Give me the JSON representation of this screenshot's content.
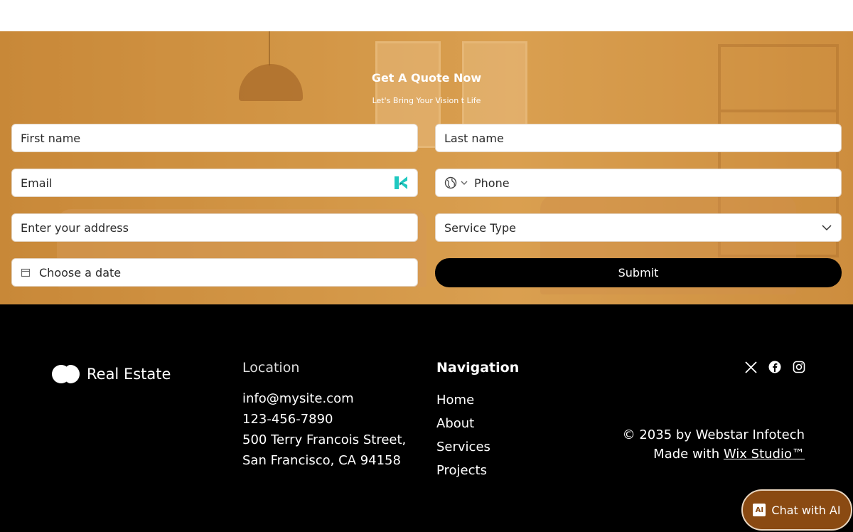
{
  "form": {
    "title": "Get A Quote Now",
    "subtitle": "Let's Bring Your Vision t Life",
    "first_name_placeholder": "First name",
    "last_name_placeholder": "Last name",
    "email_placeholder": "Email",
    "phone_placeholder": "Phone",
    "address_placeholder": "Enter your address",
    "service_placeholder": "Service Type",
    "date_placeholder": "Choose a date",
    "submit_label": "Submit"
  },
  "footer": {
    "brand": "Real Estate",
    "location": {
      "heading": "Location",
      "email": "info@mysite.com",
      "phone": "123-456-7890",
      "address_line1": "500 Terry Francois Street,",
      "address_line2": "San Francisco, CA 94158"
    },
    "navigation": {
      "heading": "Navigation",
      "items": [
        "Home",
        "About",
        "Services",
        "Projects"
      ]
    },
    "social": [
      "x-icon",
      "facebook-icon",
      "instagram-icon"
    ],
    "copyright": "© 2035 by Webstar Infotech",
    "made_with": "Made with",
    "wix_link": "Wix Studio™"
  },
  "chat": {
    "label": "Chat with AI",
    "badge": "AI"
  },
  "colors": {
    "accent": "#8a4a12",
    "hero": "#d69c4c",
    "kicon": "#1fc8c0"
  }
}
